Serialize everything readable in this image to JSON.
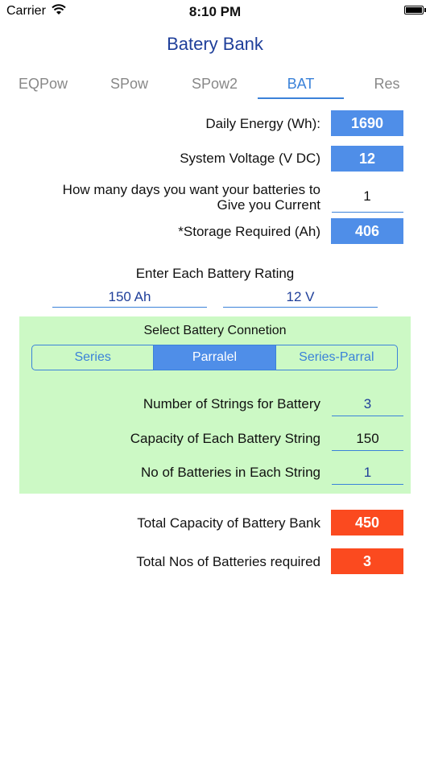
{
  "status": {
    "carrier": "Carrier",
    "time": "8:10 PM"
  },
  "title": "Batery Bank",
  "tabs": [
    {
      "label": "EQPow"
    },
    {
      "label": "SPow"
    },
    {
      "label": "SPow2"
    },
    {
      "label": "BAT",
      "active": true
    },
    {
      "label": "Res"
    }
  ],
  "daily_energy": {
    "label": "Daily Energy (Wh):",
    "value": "1690"
  },
  "system_voltage": {
    "label": "System Voltage (V DC)",
    "value": "12"
  },
  "days": {
    "label_line1": "How many days you want your batteries to",
    "label_line2": "Give you Current",
    "value": "1"
  },
  "storage": {
    "label": "*Storage Required (Ah)",
    "value": "406"
  },
  "battery_rating": {
    "label": "Enter Each Battery Rating",
    "ah": "150 Ah",
    "volt": "12 V"
  },
  "connection": {
    "label": "Select Battery Connetion",
    "options": [
      "Series",
      "Parralel",
      "Series-Parral"
    ],
    "selected": "Parralel"
  },
  "strings": {
    "label": "Number of Strings for Battery",
    "value": "3"
  },
  "capacity_string": {
    "label": "Capacity of Each Battery String",
    "value": "150"
  },
  "batteries_per_string": {
    "label": "No of Batteries in Each String",
    "value": "1"
  },
  "total_capacity": {
    "label": "Total Capacity of Battery Bank",
    "value": "450"
  },
  "total_batteries": {
    "label": "Total Nos of Batteries required",
    "value": "3"
  },
  "colors": {
    "accent": "#3b82d9",
    "value_box": "#4f8ee8",
    "result_box": "#fb4a1f",
    "panel": "#ccf9c5",
    "title": "#1f3f9a"
  }
}
